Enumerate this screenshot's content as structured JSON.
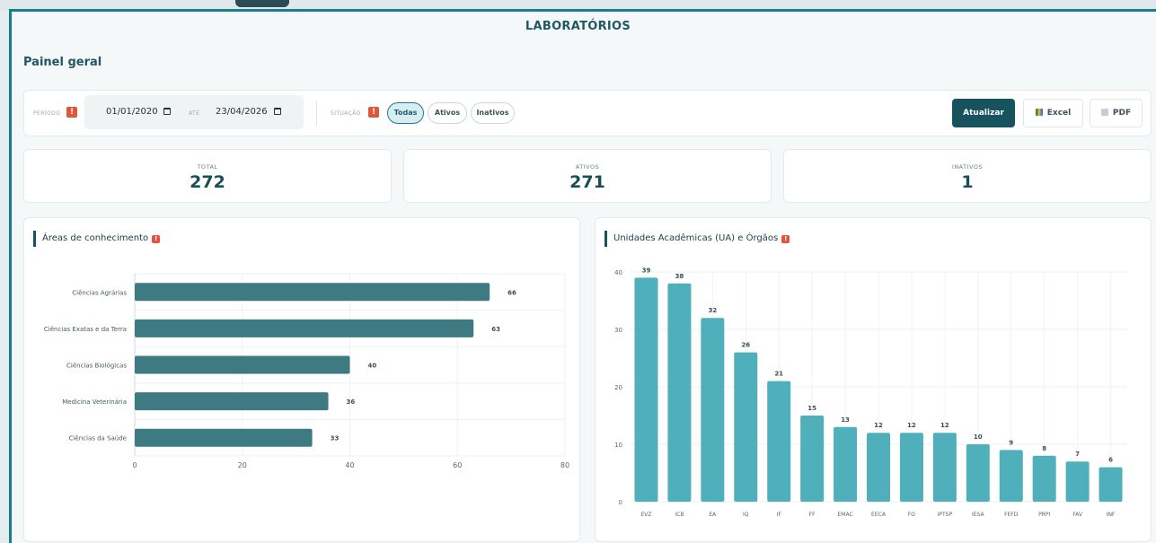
{
  "header": {
    "title": "LABORATÓRIOS",
    "panel_title": "Painel geral"
  },
  "filters": {
    "period_label": "PERÍODO",
    "date_from": "01/01/2020",
    "date_sep": "ATÉ",
    "date_to": "23/04/2026",
    "situation_label": "SITUAÇÃO",
    "options": [
      "Todas",
      "Ativos",
      "Inativos"
    ],
    "selected": "Todas"
  },
  "actions": {
    "refresh": "Atualizar",
    "excel": "Excel",
    "pdf": "PDF"
  },
  "stats": [
    {
      "label": "TOTAL",
      "value": "272"
    },
    {
      "label": "ATIVOS",
      "value": "271"
    },
    {
      "label": "INATIVOS",
      "value": "1"
    }
  ],
  "colors": {
    "accent": "#17535e",
    "bar_area": "#3d7a82",
    "bar_ua": "#4fb0bb",
    "warning": "#e0553b"
  },
  "chart_data": [
    {
      "type": "bar",
      "orientation": "horizontal",
      "title": "Áreas de conhecimento",
      "categories": [
        "Ciências Agrárias",
        "Ciências Exatas e da Terra",
        "Ciências Biológicas",
        "Medicina Veterinária",
        "Ciências da Saúde"
      ],
      "values": [
        66,
        63,
        40,
        36,
        33
      ],
      "xlim": [
        0,
        80
      ],
      "xticks": [
        0,
        20,
        40,
        60,
        80
      ],
      "grid": true
    },
    {
      "type": "bar",
      "orientation": "vertical",
      "title": "Unidades Acadêmicas (UA) e Órgãos",
      "categories": [
        "EVZ",
        "ICB",
        "EA",
        "IQ",
        "IF",
        "FF",
        "EMAC",
        "EECA",
        "FO",
        "IPTSP",
        "IESA",
        "FEFD",
        "PRPI",
        "FAV",
        "INF"
      ],
      "values": [
        39,
        38,
        32,
        26,
        21,
        15,
        13,
        12,
        12,
        12,
        10,
        9,
        8,
        7,
        6
      ],
      "ylim": [
        0,
        40
      ],
      "yticks": [
        0,
        10,
        20,
        30,
        40
      ],
      "grid": true
    }
  ]
}
